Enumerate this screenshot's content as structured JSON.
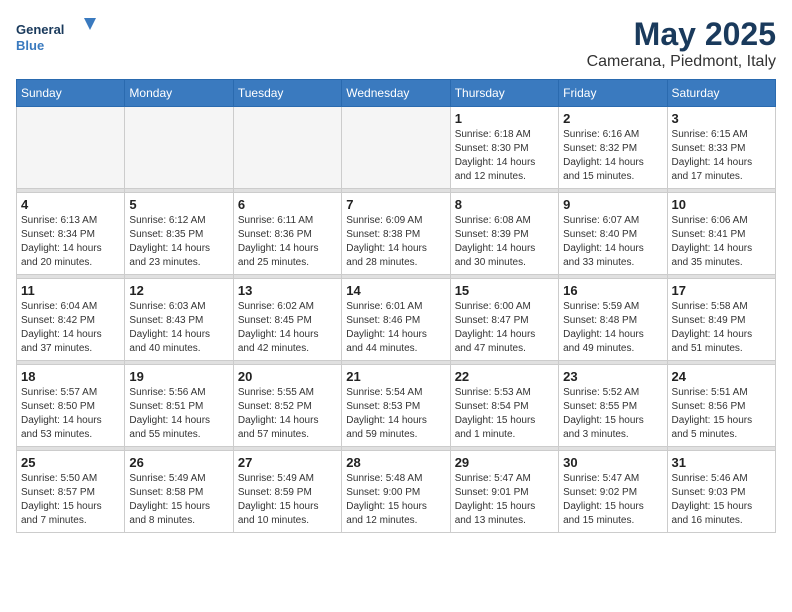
{
  "header": {
    "logo_line1": "General",
    "logo_line2": "Blue",
    "month": "May 2025",
    "location": "Camerana, Piedmont, Italy"
  },
  "weekdays": [
    "Sunday",
    "Monday",
    "Tuesday",
    "Wednesday",
    "Thursday",
    "Friday",
    "Saturday"
  ],
  "weeks": [
    [
      {
        "day": "",
        "info": ""
      },
      {
        "day": "",
        "info": ""
      },
      {
        "day": "",
        "info": ""
      },
      {
        "day": "",
        "info": ""
      },
      {
        "day": "1",
        "info": "Sunrise: 6:18 AM\nSunset: 8:30 PM\nDaylight: 14 hours\nand 12 minutes."
      },
      {
        "day": "2",
        "info": "Sunrise: 6:16 AM\nSunset: 8:32 PM\nDaylight: 14 hours\nand 15 minutes."
      },
      {
        "day": "3",
        "info": "Sunrise: 6:15 AM\nSunset: 8:33 PM\nDaylight: 14 hours\nand 17 minutes."
      }
    ],
    [
      {
        "day": "4",
        "info": "Sunrise: 6:13 AM\nSunset: 8:34 PM\nDaylight: 14 hours\nand 20 minutes."
      },
      {
        "day": "5",
        "info": "Sunrise: 6:12 AM\nSunset: 8:35 PM\nDaylight: 14 hours\nand 23 minutes."
      },
      {
        "day": "6",
        "info": "Sunrise: 6:11 AM\nSunset: 8:36 PM\nDaylight: 14 hours\nand 25 minutes."
      },
      {
        "day": "7",
        "info": "Sunrise: 6:09 AM\nSunset: 8:38 PM\nDaylight: 14 hours\nand 28 minutes."
      },
      {
        "day": "8",
        "info": "Sunrise: 6:08 AM\nSunset: 8:39 PM\nDaylight: 14 hours\nand 30 minutes."
      },
      {
        "day": "9",
        "info": "Sunrise: 6:07 AM\nSunset: 8:40 PM\nDaylight: 14 hours\nand 33 minutes."
      },
      {
        "day": "10",
        "info": "Sunrise: 6:06 AM\nSunset: 8:41 PM\nDaylight: 14 hours\nand 35 minutes."
      }
    ],
    [
      {
        "day": "11",
        "info": "Sunrise: 6:04 AM\nSunset: 8:42 PM\nDaylight: 14 hours\nand 37 minutes."
      },
      {
        "day": "12",
        "info": "Sunrise: 6:03 AM\nSunset: 8:43 PM\nDaylight: 14 hours\nand 40 minutes."
      },
      {
        "day": "13",
        "info": "Sunrise: 6:02 AM\nSunset: 8:45 PM\nDaylight: 14 hours\nand 42 minutes."
      },
      {
        "day": "14",
        "info": "Sunrise: 6:01 AM\nSunset: 8:46 PM\nDaylight: 14 hours\nand 44 minutes."
      },
      {
        "day": "15",
        "info": "Sunrise: 6:00 AM\nSunset: 8:47 PM\nDaylight: 14 hours\nand 47 minutes."
      },
      {
        "day": "16",
        "info": "Sunrise: 5:59 AM\nSunset: 8:48 PM\nDaylight: 14 hours\nand 49 minutes."
      },
      {
        "day": "17",
        "info": "Sunrise: 5:58 AM\nSunset: 8:49 PM\nDaylight: 14 hours\nand 51 minutes."
      }
    ],
    [
      {
        "day": "18",
        "info": "Sunrise: 5:57 AM\nSunset: 8:50 PM\nDaylight: 14 hours\nand 53 minutes."
      },
      {
        "day": "19",
        "info": "Sunrise: 5:56 AM\nSunset: 8:51 PM\nDaylight: 14 hours\nand 55 minutes."
      },
      {
        "day": "20",
        "info": "Sunrise: 5:55 AM\nSunset: 8:52 PM\nDaylight: 14 hours\nand 57 minutes."
      },
      {
        "day": "21",
        "info": "Sunrise: 5:54 AM\nSunset: 8:53 PM\nDaylight: 14 hours\nand 59 minutes."
      },
      {
        "day": "22",
        "info": "Sunrise: 5:53 AM\nSunset: 8:54 PM\nDaylight: 15 hours\nand 1 minute."
      },
      {
        "day": "23",
        "info": "Sunrise: 5:52 AM\nSunset: 8:55 PM\nDaylight: 15 hours\nand 3 minutes."
      },
      {
        "day": "24",
        "info": "Sunrise: 5:51 AM\nSunset: 8:56 PM\nDaylight: 15 hours\nand 5 minutes."
      }
    ],
    [
      {
        "day": "25",
        "info": "Sunrise: 5:50 AM\nSunset: 8:57 PM\nDaylight: 15 hours\nand 7 minutes."
      },
      {
        "day": "26",
        "info": "Sunrise: 5:49 AM\nSunset: 8:58 PM\nDaylight: 15 hours\nand 8 minutes."
      },
      {
        "day": "27",
        "info": "Sunrise: 5:49 AM\nSunset: 8:59 PM\nDaylight: 15 hours\nand 10 minutes."
      },
      {
        "day": "28",
        "info": "Sunrise: 5:48 AM\nSunset: 9:00 PM\nDaylight: 15 hours\nand 12 minutes."
      },
      {
        "day": "29",
        "info": "Sunrise: 5:47 AM\nSunset: 9:01 PM\nDaylight: 15 hours\nand 13 minutes."
      },
      {
        "day": "30",
        "info": "Sunrise: 5:47 AM\nSunset: 9:02 PM\nDaylight: 15 hours\nand 15 minutes."
      },
      {
        "day": "31",
        "info": "Sunrise: 5:46 AM\nSunset: 9:03 PM\nDaylight: 15 hours\nand 16 minutes."
      }
    ]
  ]
}
